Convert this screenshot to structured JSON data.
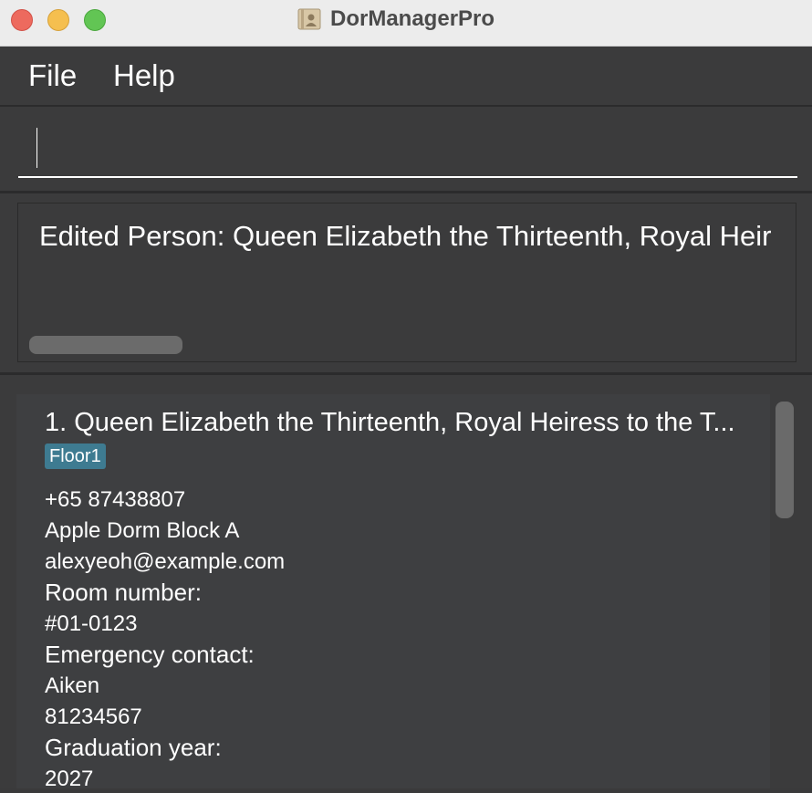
{
  "window": {
    "title": "DorManagerPro"
  },
  "menu": {
    "items": [
      "File",
      "Help"
    ]
  },
  "command": {
    "value": "",
    "placeholder": ""
  },
  "result": {
    "message": "Edited Person: Queen Elizabeth the Thirteenth, Royal Heir"
  },
  "person_list": [
    {
      "name": "1. Queen Elizabeth the Thirteenth, Royal Heiress to the T...",
      "tag": "Floor1",
      "phone": "+65 87438807",
      "address": "Apple Dorm Block A",
      "email": "alexyeoh@example.com",
      "room_label": "Room number:",
      "room": "#01-0123",
      "emergency_label": "Emergency contact:",
      "emergency_name": "Aiken",
      "emergency_phone": "81234567",
      "graduation_label": "Graduation year:",
      "graduation_year": "2027"
    }
  ],
  "colors": {
    "background": "#3a3a3b",
    "tag": "#3e7b91"
  }
}
